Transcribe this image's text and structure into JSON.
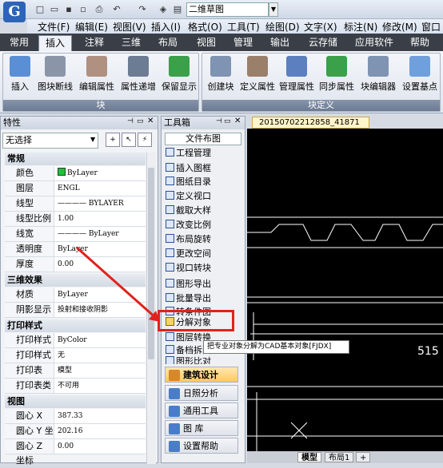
{
  "app": {
    "logo": "G",
    "doc_title": "二维草图"
  },
  "menu": [
    "文件(F)",
    "编辑(E)",
    "视图(V)",
    "插入(I)",
    "格式(O)",
    "工具(T)",
    "绘图(D)",
    "文字(X)",
    "标注(N)",
    "修改(M)",
    "窗口"
  ],
  "ribbon_tabs": [
    "常用",
    "插入",
    "注释",
    "三维",
    "布局",
    "视图",
    "管理",
    "输出",
    "云存储",
    "应用软件",
    "帮助"
  ],
  "ribbon": {
    "block_group": "块",
    "block_buttons": [
      "插入",
      "图块断线",
      "编辑属性",
      "属性递增",
      "保留显示"
    ],
    "blockdef_group": "块定义",
    "blockdef_buttons": [
      "创建块",
      "定义属性",
      "管理属性",
      "同步属性",
      "块编辑器",
      "设置基点"
    ]
  },
  "props": {
    "title": "特性",
    "selector": "无选择",
    "sec_general": "常规",
    "general": [
      [
        "颜色",
        "ByLayer"
      ],
      [
        "图层",
        "ENGL"
      ],
      [
        "线型",
        "———— BYLAYER"
      ],
      [
        "线型比例",
        "1.00"
      ],
      [
        "线宽",
        "———— ByLayer"
      ],
      [
        "透明度",
        "ByLayer"
      ],
      [
        "厚度",
        "0.00"
      ]
    ],
    "sec_3d": "三维效果",
    "effects": [
      [
        "材质",
        "ByLayer"
      ],
      [
        "阴影显示",
        "投射和接收阴影"
      ]
    ],
    "sec_print": "打印样式",
    "print": [
      [
        "打印样式",
        "ByColor"
      ],
      [
        "打印样式表",
        "无"
      ],
      [
        "打印表附...",
        "模型"
      ],
      [
        "打印表类型",
        "不可用"
      ]
    ],
    "sec_view": "视图",
    "view": [
      [
        "圆心 X 坐标",
        "387.33"
      ],
      [
        "圆心 Y 坐标",
        "202.16"
      ],
      [
        "圆心 Z 坐标",
        "0.00"
      ]
    ]
  },
  "toolbox": {
    "title": "工具箱",
    "combo": "文件布图",
    "items": [
      "工程管理",
      "插入图框",
      "图纸目录",
      "定义视口",
      "截取大样",
      "改变比例",
      "布局旋转",
      "更改空间",
      "视口转块",
      "图形导出",
      "批量导出",
      "转条件图",
      "分解对象",
      "图层转换",
      "备档拆图",
      "图形比对"
    ],
    "categories": [
      "建筑设计",
      "日照分析",
      "通用工具",
      "图   库",
      "设置帮助"
    ],
    "tooltip": "把专业对象分解为CAD基本对象[FJDX]"
  },
  "drawing": {
    "tab": "20150702212858_41871",
    "number": "515",
    "layout_tabs": [
      "模型",
      "布局1",
      "+"
    ]
  },
  "colors": {
    "accent": "#e0221c",
    "ribbon_dark": "#3a3f47",
    "canvas": "#000000",
    "color_swatch": "#19c43a"
  }
}
